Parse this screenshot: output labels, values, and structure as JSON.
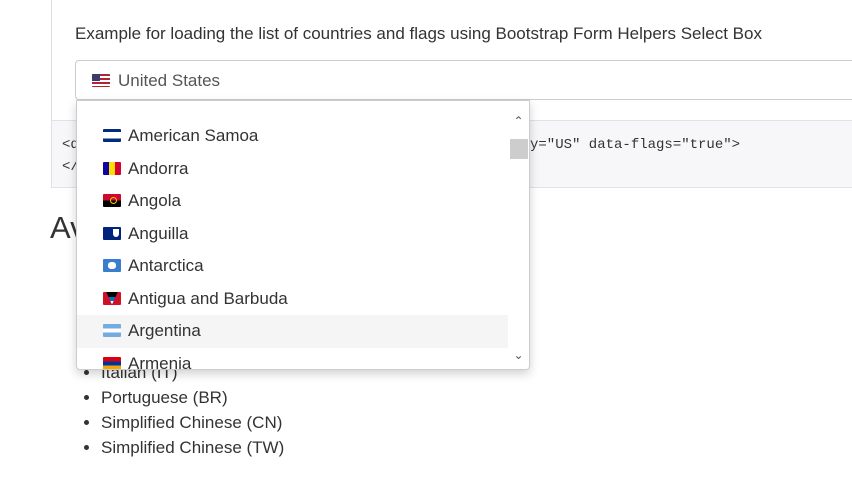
{
  "example": {
    "description": "Example for loading the list of countries and flags using Bootstrap Form Helpers Select Box",
    "selected_country": "United States",
    "selected_flag": "us-flag-icon"
  },
  "code": {
    "line1_start": "<d",
    "line1_end": "y=\"US\" data-flags=\"true\">",
    "line2": "</"
  },
  "heading": "Av",
  "languages": [
    "Italian (IT)",
    "Portuguese (BR)",
    "Simplified Chinese (CN)",
    "Simplified Chinese (TW)"
  ],
  "dropdown": {
    "items": [
      {
        "label": "American Samoa",
        "flag": "american-samoa-flag-icon"
      },
      {
        "label": "Andorra",
        "flag": "andorra-flag-icon"
      },
      {
        "label": "Angola",
        "flag": "angola-flag-icon"
      },
      {
        "label": "Anguilla",
        "flag": "anguilla-flag-icon"
      },
      {
        "label": "Antarctica",
        "flag": "antarctica-flag-icon"
      },
      {
        "label": "Antigua and Barbuda",
        "flag": "antigua-and-barbuda-flag-icon"
      },
      {
        "label": "Argentina",
        "flag": "argentina-flag-icon"
      },
      {
        "label": "Armenia",
        "flag": "armenia-flag-icon"
      }
    ],
    "hovered_item": "Argentina",
    "scroll_up_icon": "chevron-up-icon",
    "scroll_down_icon": "chevron-down-icon"
  }
}
